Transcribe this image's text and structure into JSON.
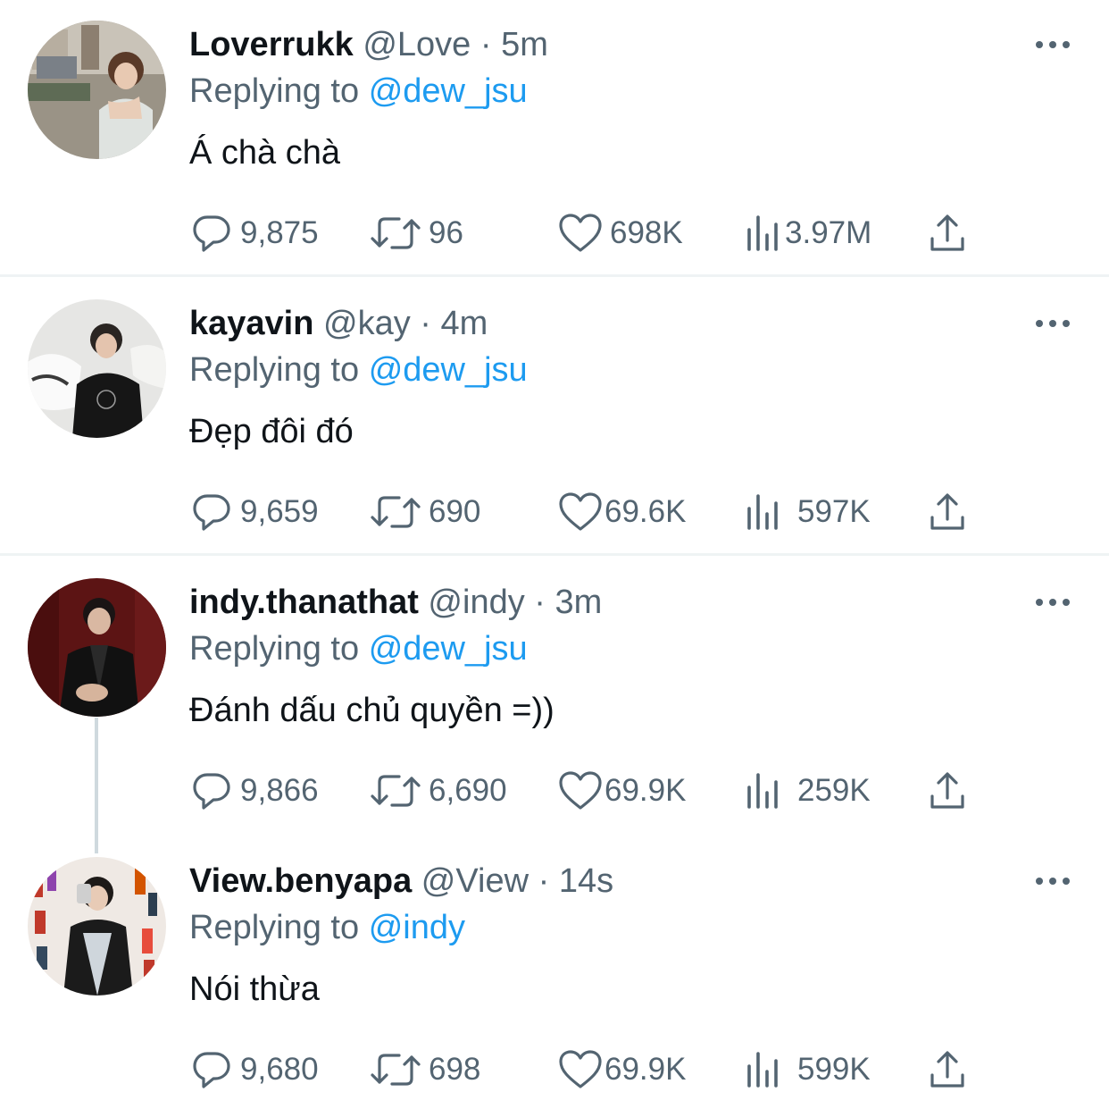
{
  "tweets": [
    {
      "name": "Loverrukk",
      "handle": "@Love",
      "dot": "·",
      "time": "5m",
      "replying_prefix": "Replying to",
      "replying_to": "@dew_jsu",
      "text": "Á chà chà",
      "replies": "9,875",
      "retweets": "96",
      "likes": "698K",
      "views": "3.97M"
    },
    {
      "name": "kayavin",
      "handle": "@kay",
      "dot": "·",
      "time": "4m",
      "replying_prefix": "Replying to",
      "replying_to": "@dew_jsu",
      "text": "Đẹp đôi đó",
      "replies": "9,659",
      "retweets": "690",
      "likes": "69.6K",
      "views": "597K"
    },
    {
      "name": "indy.thanathat",
      "handle": "@indy",
      "dot": "·",
      "time": "3m",
      "replying_prefix": "Replying to",
      "replying_to": "@dew_jsu",
      "text": "Đánh dấu chủ quyền =))",
      "replies": "9,866",
      "retweets": "6,690",
      "likes": "69.9K",
      "views": "259K"
    },
    {
      "name": "View.benyapa",
      "handle": "@View",
      "dot": "·",
      "time": "14s",
      "replying_prefix": "Replying to",
      "replying_to": "@indy",
      "text": "Nói thừa",
      "replies": "9,680",
      "retweets": "698",
      "likes": "69.9K",
      "views": "599K"
    }
  ],
  "icons": {
    "more": "more-horizontal-icon",
    "reply": "reply-bubble-icon",
    "retweet": "retweet-icon",
    "like": "heart-icon",
    "views": "views-bar-chart-icon",
    "share": "share-upload-icon"
  },
  "colors": {
    "text_primary": "#0f1419",
    "text_secondary": "#536471",
    "link": "#1d9bf0",
    "divider": "#eff3f4",
    "thread_line": "#cfd9de"
  }
}
